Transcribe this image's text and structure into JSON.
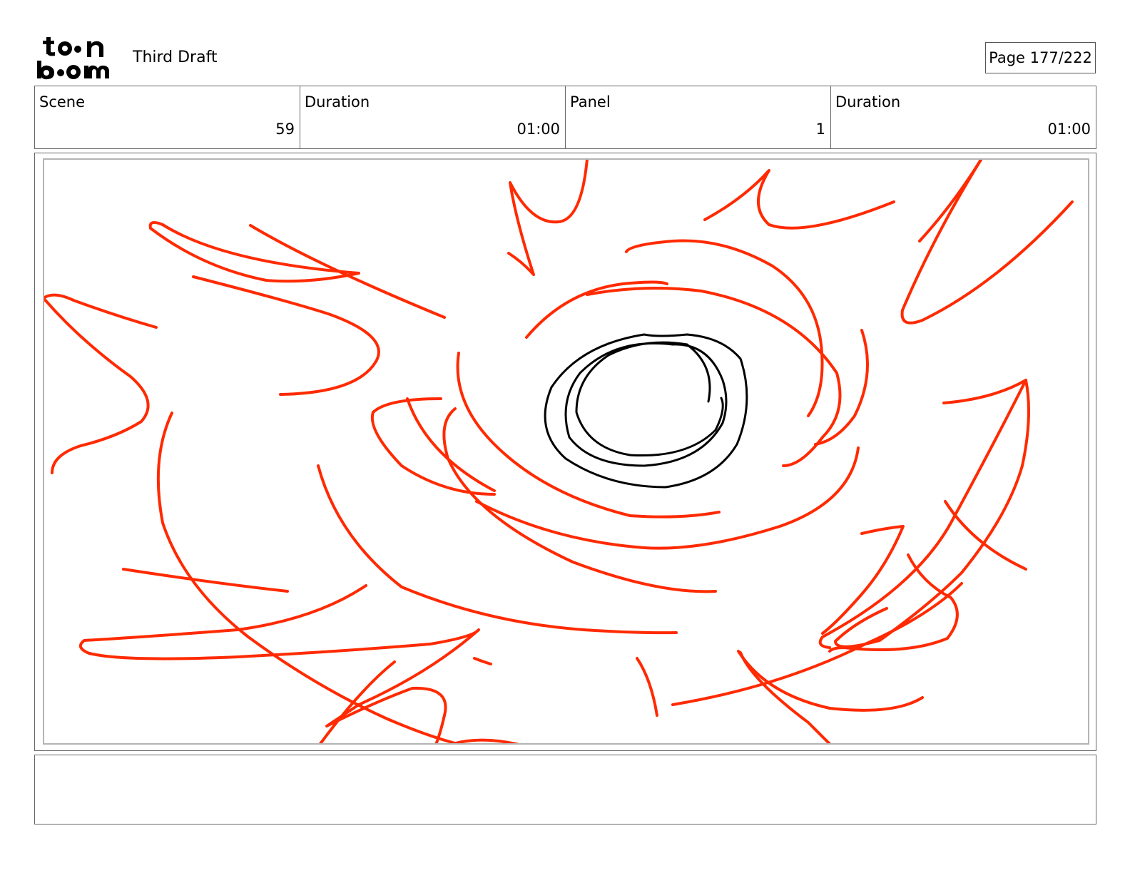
{
  "header": {
    "logo_text": "toon boom",
    "draft_title": "Third Draft",
    "page_label": "Page 177/222"
  },
  "info": {
    "scene_label": "Scene",
    "scene_value": "59",
    "scene_duration_label": "Duration",
    "scene_duration_value": "01:00",
    "panel_label": "Panel",
    "panel_value": "1",
    "panel_duration_label": "Duration",
    "panel_duration_value": "01:00"
  },
  "panel": {
    "stroke_color_effect": "#ff2a00",
    "stroke_color_object": "#000000"
  },
  "notes": {
    "text": ""
  }
}
